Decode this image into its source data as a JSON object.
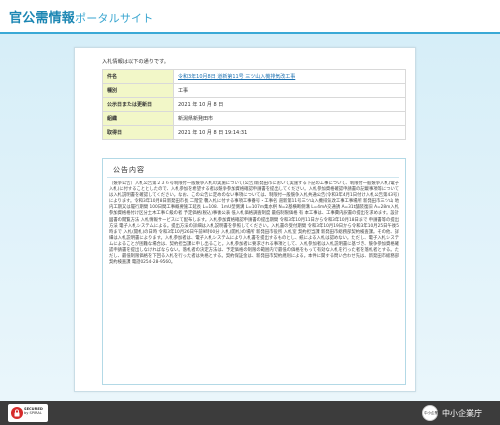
{
  "header": {
    "title": "官公需情報",
    "subtitle": "ポータルサイト"
  },
  "intro": "入札情報は以下の通りです。",
  "info": {
    "rows": [
      {
        "label": "件名",
        "value": "令和3年10月8日 道新第11号 三ツ山入機排気改工事",
        "link": true
      },
      {
        "label": "種別",
        "value": "工事"
      },
      {
        "label": "公示日または更新日",
        "value": "2021 年 10 月 8 日"
      },
      {
        "label": "組織",
        "value": "新潟県新発田市"
      },
      {
        "label": "取得日",
        "value": "2021 年 10 月 8 日 19:14:31"
      }
    ]
  },
  "notice": {
    "title": "公告内容",
    "body": "（競争公告）入札公告第２３６号制限付一般競争入札の実施について(公告)新発田市において実施する下記の工事について、制限付一般競争入札(電子入札)に付することとしたので、入札参加を希望する者は競争参加資格確認申請書を提出してください。入札参加資格確認申請書の記載事項等については入札説明書を確認してください。なお、この公告に定めのない事項については、制限付一般競争入札共通公告(令和3年4月1日付け入札公告第43号)によります。令和3年10月8日新発田市長 二階堂 馨入札に付する事項工事番号・工事名 道新第11号三ツ山入機排気改工事工事場所 新発田市三ツ山 地内工期又は履行期間 100日間工事概要施工延長 L=108．1mU型側溝 L=107m集水桝 N=2基横断側溝 L=4mA交通誘 A=31t舗装復旧 A=28m入札参加資格格付け区分土木工事Ｃ級の者 予定価格(税込)事後公表 低入札価格調査制度 最低制限価格 有 本工事は、工事費内訳書の提出を求めます。設計図書の閲覧方法 入札情報サービスにて配布します。入札参加資格確認申請書の提出期間 令和3年10月11日から令和3年10月18日まで 申請書等の提出方法 電子入札システムによる。提出方法の詳細は入札説明書を参照してください。入札書の受付期間 令和3年10月19日から令和3年10月25日午後5時まで 入札(開札)の日時 令和3年10月26日午前9時00分 入札(開札)の場所 新発田市役所 入札室 契約担当課 新発田市総務部契約検査課。その他、詳細は入札説明書によります。入札参加者は、電子入札システムにより入札書を提出するものとし、紙による入札は認めない。ただし、電子入札システムによることが困難な場合は、契約担当課に申し出ること。入札参加者に要求される事項として、入札参加者は入札説明書に基づき、競争参加資格確認申請書を提出しなければならない。落札者の決定方法は、予定価格の制限の範囲内で最低の価格をもって有効な入札を行った者を落札者とする。ただし、最低制限価格を下回る入札を行った者は失格とする。契約保証金は、新発田市契約規則による。本件に関する問い合わせ先は、新発田市総務部契約検査課 電話0254-28-9560。"
  },
  "footer": {
    "secured_title": "SECURED",
    "secured_by": "by SPIRAL",
    "sme_badge": "中小企業庁",
    "sme_name": "中小企業庁"
  },
  "colors": {
    "accent": "#1b86b3",
    "header_line": "#3aa9d6",
    "label_bg": "#f2f7c8",
    "footer_bg": "#3c3c3c"
  }
}
